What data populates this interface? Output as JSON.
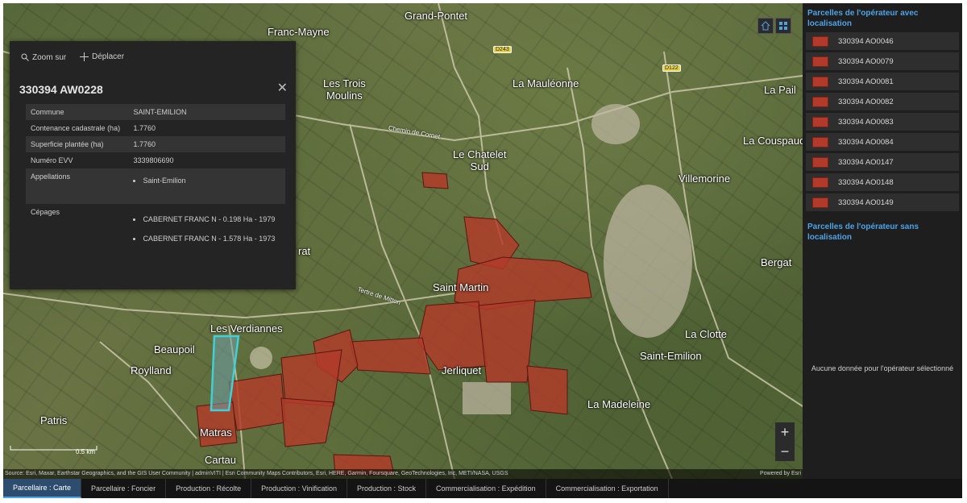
{
  "popup": {
    "action_zoom": "Zoom sur",
    "action_move": "Déplacer",
    "title": "330394  AW0228",
    "rows": [
      {
        "label": "Commune",
        "value": "SAINT-EMILION"
      },
      {
        "label": "Contenance cadastrale (ha)",
        "value": "1.7760"
      },
      {
        "label": "Superficie plantée (ha)",
        "value": "1.7760"
      },
      {
        "label": "Numéro EVV",
        "value": "3339806690"
      }
    ],
    "appellations_label": "Appellations",
    "appellations": [
      "Saint-Emilion"
    ],
    "cepages_label": "Cépages",
    "cepages": [
      "CABERNET FRANC N - 0.198 Ha - 1979",
      "CABERNET FRANC N - 1.578 Ha - 1973"
    ]
  },
  "map": {
    "places": {
      "grand_pontet": "Grand-Pontet",
      "franc_mayne": "Franc-Mayne",
      "les_trois_moulins": "Les Trois\nMoulins",
      "la_mauleonne": "La Mauléonne",
      "la_pail": "La Pail",
      "la_couspaude": "La Couspaude",
      "le_chatelet_sud": "Le Chatelet\nSud",
      "villemorine": "Villemorine",
      "rat": "rat",
      "bergat": "Bergat",
      "saint_martin": "Saint Martin",
      "les_verdiannes": "Les Verdiannes",
      "beaupoil": "Beaupoil",
      "roylland": "Roylland",
      "la_clotte": "La Clotte",
      "saint_emilion": "Saint-Emilion",
      "jerliquet": "Jerliquet",
      "la_madeleine": "La Madeleine",
      "patris": "Patris",
      "matras": "Matras",
      "cartau": "Cartau"
    },
    "road_labels": {
      "route1": "Chemin de Cornet",
      "route2": "Tertre de Mitton"
    },
    "shields": {
      "d243": "D243",
      "d122": "D122"
    },
    "scale_label": "0.5 km",
    "attribution": "Source: Esri, Maxar, Earthstar Geographics, and the GIS User Community | adminVITI | Esri Community Maps Contributors, Esri, HERE, Garmin, Foursquare, GeoTechnologies, Inc, METI/NASA, USGS",
    "powered_by": "Powered by Esri",
    "zoom_in": "+",
    "zoom_out": "−"
  },
  "panel": {
    "with_loc_title": "Parcelles de l'opérateur avec localisation",
    "parcels": [
      "330394 AO0046",
      "330394 AO0079",
      "330394 AO0081",
      "330394 AO0082",
      "330394 AO0083",
      "330394 AO0084",
      "330394 AO0147",
      "330394 AO0148",
      "330394 AO0149"
    ],
    "without_loc_title": "Parcelles de l'opérateur sans localisation",
    "no_data": "Aucune donnée pour l'opérateur sélectionné"
  },
  "tabs": [
    "Parcellaire : Carte",
    "Parcellaire : Foncier",
    "Production : Récolte",
    "Production : Vinification",
    "Production : Stock",
    "Commercialisation : Expédition",
    "Commercialisation : Exportation"
  ],
  "colors": {
    "accent": "#4ea3e6",
    "parcel_fill": "#b23a2a",
    "selected_parcel": "#3fd0d8"
  }
}
